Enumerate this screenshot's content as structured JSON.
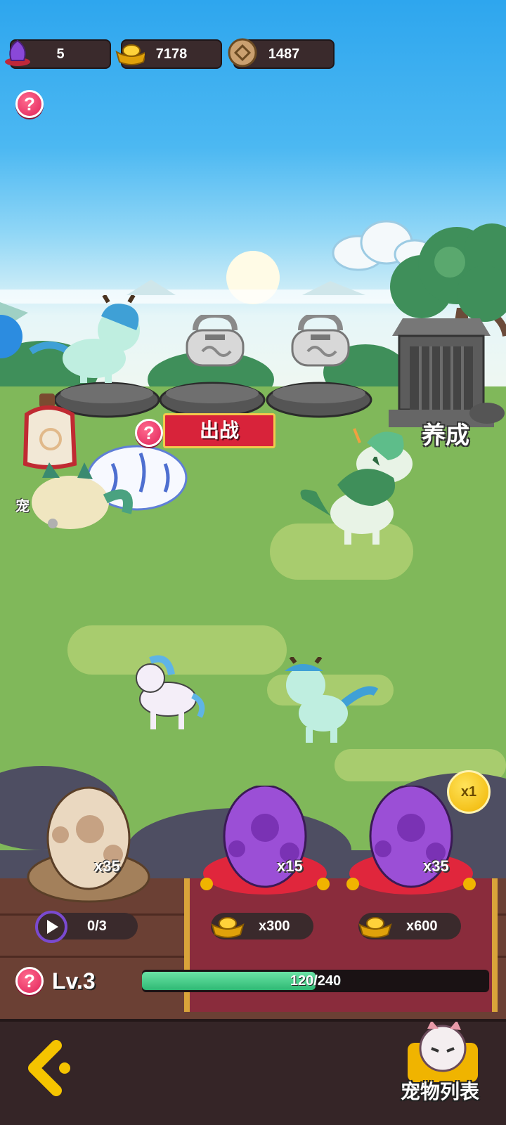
{
  "resources": {
    "gems": "5",
    "gold": "7178",
    "coins": "1487"
  },
  "buttons": {
    "battle": "出战",
    "train": "养成",
    "help": "?",
    "speed": "x1",
    "pet_list": "宠物列表"
  },
  "side_partial_label": "宠",
  "eggs": [
    {
      "kind": "common",
      "count": "x35",
      "cost_label": "0/3"
    },
    {
      "kind": "purple",
      "count": "x15",
      "cost_label": "x300"
    },
    {
      "kind": "purple",
      "count": "x35",
      "cost_label": "x600"
    }
  ],
  "player": {
    "level": "Lv.3",
    "xp_text": "120/240",
    "xp_fraction": 0.5
  },
  "colors": {
    "accent_red": "#d8233a",
    "gold": "#f0b400",
    "xp_green": "#2fb974",
    "egg_purple": "#9b4fd6"
  }
}
